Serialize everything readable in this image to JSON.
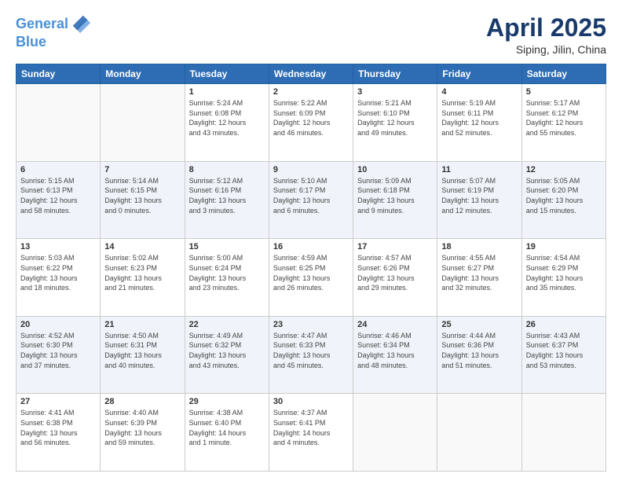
{
  "header": {
    "logo_line1": "General",
    "logo_line2": "Blue",
    "title": "April 2025",
    "subtitle": "Siping, Jilin, China"
  },
  "weekdays": [
    "Sunday",
    "Monday",
    "Tuesday",
    "Wednesday",
    "Thursday",
    "Friday",
    "Saturday"
  ],
  "weeks": [
    [
      {
        "day": "",
        "info": ""
      },
      {
        "day": "",
        "info": ""
      },
      {
        "day": "1",
        "info": "Sunrise: 5:24 AM\nSunset: 6:08 PM\nDaylight: 12 hours\nand 43 minutes."
      },
      {
        "day": "2",
        "info": "Sunrise: 5:22 AM\nSunset: 6:09 PM\nDaylight: 12 hours\nand 46 minutes."
      },
      {
        "day": "3",
        "info": "Sunrise: 5:21 AM\nSunset: 6:10 PM\nDaylight: 12 hours\nand 49 minutes."
      },
      {
        "day": "4",
        "info": "Sunrise: 5:19 AM\nSunset: 6:11 PM\nDaylight: 12 hours\nand 52 minutes."
      },
      {
        "day": "5",
        "info": "Sunrise: 5:17 AM\nSunset: 6:12 PM\nDaylight: 12 hours\nand 55 minutes."
      }
    ],
    [
      {
        "day": "6",
        "info": "Sunrise: 5:15 AM\nSunset: 6:13 PM\nDaylight: 12 hours\nand 58 minutes."
      },
      {
        "day": "7",
        "info": "Sunrise: 5:14 AM\nSunset: 6:15 PM\nDaylight: 13 hours\nand 0 minutes."
      },
      {
        "day": "8",
        "info": "Sunrise: 5:12 AM\nSunset: 6:16 PM\nDaylight: 13 hours\nand 3 minutes."
      },
      {
        "day": "9",
        "info": "Sunrise: 5:10 AM\nSunset: 6:17 PM\nDaylight: 13 hours\nand 6 minutes."
      },
      {
        "day": "10",
        "info": "Sunrise: 5:09 AM\nSunset: 6:18 PM\nDaylight: 13 hours\nand 9 minutes."
      },
      {
        "day": "11",
        "info": "Sunrise: 5:07 AM\nSunset: 6:19 PM\nDaylight: 13 hours\nand 12 minutes."
      },
      {
        "day": "12",
        "info": "Sunrise: 5:05 AM\nSunset: 6:20 PM\nDaylight: 13 hours\nand 15 minutes."
      }
    ],
    [
      {
        "day": "13",
        "info": "Sunrise: 5:03 AM\nSunset: 6:22 PM\nDaylight: 13 hours\nand 18 minutes."
      },
      {
        "day": "14",
        "info": "Sunrise: 5:02 AM\nSunset: 6:23 PM\nDaylight: 13 hours\nand 21 minutes."
      },
      {
        "day": "15",
        "info": "Sunrise: 5:00 AM\nSunset: 6:24 PM\nDaylight: 13 hours\nand 23 minutes."
      },
      {
        "day": "16",
        "info": "Sunrise: 4:59 AM\nSunset: 6:25 PM\nDaylight: 13 hours\nand 26 minutes."
      },
      {
        "day": "17",
        "info": "Sunrise: 4:57 AM\nSunset: 6:26 PM\nDaylight: 13 hours\nand 29 minutes."
      },
      {
        "day": "18",
        "info": "Sunrise: 4:55 AM\nSunset: 6:27 PM\nDaylight: 13 hours\nand 32 minutes."
      },
      {
        "day": "19",
        "info": "Sunrise: 4:54 AM\nSunset: 6:29 PM\nDaylight: 13 hours\nand 35 minutes."
      }
    ],
    [
      {
        "day": "20",
        "info": "Sunrise: 4:52 AM\nSunset: 6:30 PM\nDaylight: 13 hours\nand 37 minutes."
      },
      {
        "day": "21",
        "info": "Sunrise: 4:50 AM\nSunset: 6:31 PM\nDaylight: 13 hours\nand 40 minutes."
      },
      {
        "day": "22",
        "info": "Sunrise: 4:49 AM\nSunset: 6:32 PM\nDaylight: 13 hours\nand 43 minutes."
      },
      {
        "day": "23",
        "info": "Sunrise: 4:47 AM\nSunset: 6:33 PM\nDaylight: 13 hours\nand 45 minutes."
      },
      {
        "day": "24",
        "info": "Sunrise: 4:46 AM\nSunset: 6:34 PM\nDaylight: 13 hours\nand 48 minutes."
      },
      {
        "day": "25",
        "info": "Sunrise: 4:44 AM\nSunset: 6:36 PM\nDaylight: 13 hours\nand 51 minutes."
      },
      {
        "day": "26",
        "info": "Sunrise: 4:43 AM\nSunset: 6:37 PM\nDaylight: 13 hours\nand 53 minutes."
      }
    ],
    [
      {
        "day": "27",
        "info": "Sunrise: 4:41 AM\nSunset: 6:38 PM\nDaylight: 13 hours\nand 56 minutes."
      },
      {
        "day": "28",
        "info": "Sunrise: 4:40 AM\nSunset: 6:39 PM\nDaylight: 13 hours\nand 59 minutes."
      },
      {
        "day": "29",
        "info": "Sunrise: 4:38 AM\nSunset: 6:40 PM\nDaylight: 14 hours\nand 1 minute."
      },
      {
        "day": "30",
        "info": "Sunrise: 4:37 AM\nSunset: 6:41 PM\nDaylight: 14 hours\nand 4 minutes."
      },
      {
        "day": "",
        "info": ""
      },
      {
        "day": "",
        "info": ""
      },
      {
        "day": "",
        "info": ""
      }
    ]
  ]
}
